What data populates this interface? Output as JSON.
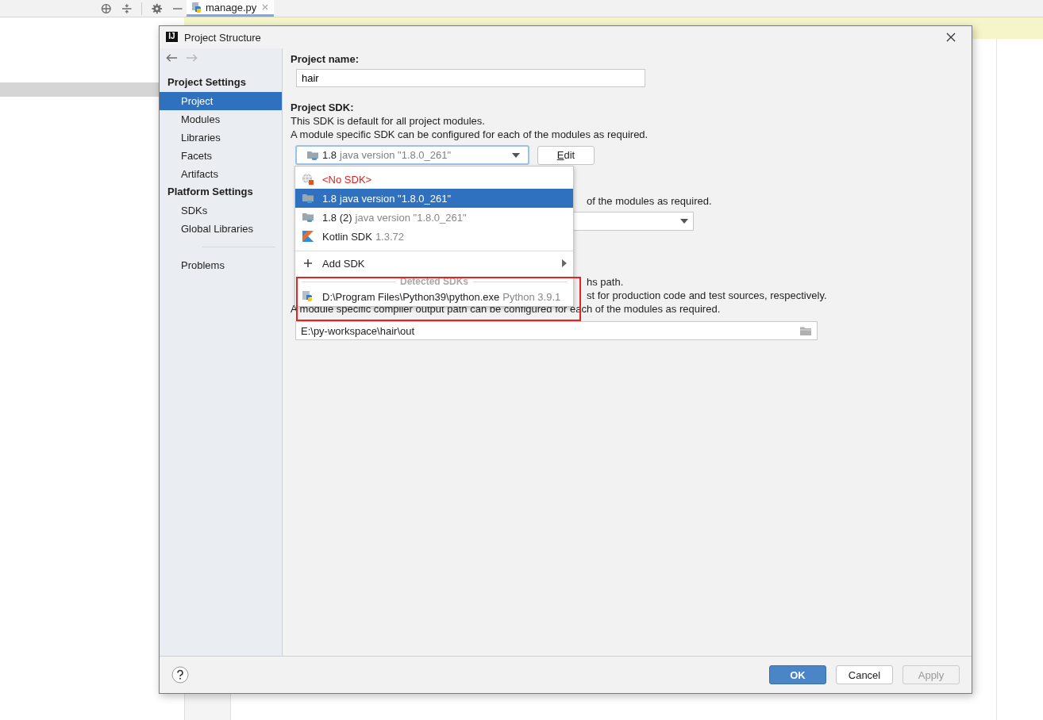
{
  "editor_tab": {
    "label": "manage.py"
  },
  "dialog": {
    "app_logo": "IJ",
    "title": "Project Structure",
    "sidebar": {
      "sections": [
        {
          "heading": "Project Settings",
          "items": [
            {
              "label": "Project",
              "selected": true
            },
            {
              "label": "Modules",
              "selected": false
            },
            {
              "label": "Libraries",
              "selected": false
            },
            {
              "label": "Facets",
              "selected": false
            },
            {
              "label": "Artifacts",
              "selected": false
            }
          ]
        },
        {
          "heading": "Platform Settings",
          "items": [
            {
              "label": "SDKs",
              "selected": false
            },
            {
              "label": "Global Libraries",
              "selected": false
            }
          ]
        }
      ],
      "extra_items": [
        {
          "label": "Problems",
          "selected": false
        }
      ]
    },
    "project_name": {
      "label": "Project name:",
      "value": "hair"
    },
    "project_sdk": {
      "label": "Project SDK:",
      "description": [
        "This SDK is default for all project modules.",
        "A module specific SDK can be configured for each of the modules as required."
      ],
      "combo": {
        "name": "1.8",
        "detail": "java version \"1.8.0_261\""
      },
      "edit_button": "Edit"
    },
    "language_level": {
      "visible_text": "of the modules as required."
    },
    "compiler_output": {
      "visible_lines": [
        "hs path.",
        "st for production code and test sources, respectively.",
        "A module specific compiler output path can be configured for each of the modules as required."
      ],
      "value": "E:\\py-workspace\\hair\\out"
    },
    "sdk_popup": {
      "items": [
        {
          "kind": "none",
          "name": "<No SDK>",
          "selected": false
        },
        {
          "kind": "java",
          "name": "1.8",
          "detail": "java version \"1.8.0_261\"",
          "selected": true
        },
        {
          "kind": "java",
          "name": "1.8 (2)",
          "detail": "java version \"1.8.0_261\"",
          "selected": false
        },
        {
          "kind": "kotlin",
          "name": "Kotlin SDK",
          "detail": "1.3.72",
          "selected": false
        }
      ],
      "add_item": "Add SDK",
      "group_heading": "Detected SDKs",
      "detected": [
        {
          "kind": "python",
          "name": "D:\\Program Files\\Python39\\python.exe",
          "detail": "Python 3.9.1",
          "selected": false
        }
      ]
    },
    "buttons": [
      {
        "label": "OK",
        "kind": "primary"
      },
      {
        "label": "Cancel",
        "kind": "normal"
      },
      {
        "label": "Apply",
        "kind": "disabled"
      }
    ]
  }
}
